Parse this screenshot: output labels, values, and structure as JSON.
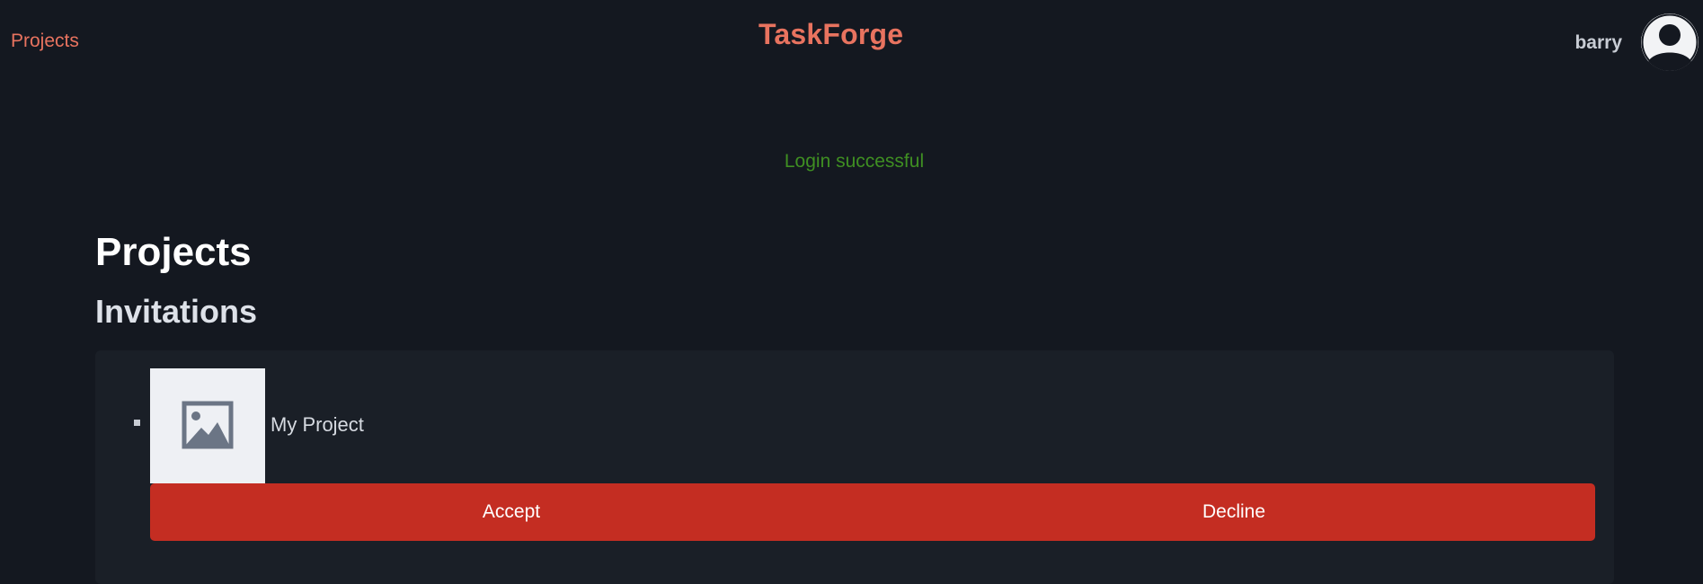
{
  "header": {
    "nav_projects_label": "Projects",
    "brand": "TaskForge",
    "username": "barry",
    "avatar_icon": "user-circle-icon"
  },
  "flash": {
    "message": "Login successful",
    "color": "#3f8f22"
  },
  "main": {
    "title": "Projects",
    "invitations": {
      "heading": "Invitations",
      "items": [
        {
          "project_name": "My Project",
          "thumbnail_icon": "image-placeholder-icon",
          "accept_label": "Accept",
          "decline_label": "Decline"
        }
      ]
    }
  },
  "colors": {
    "background": "#141820",
    "card": "#1a1f27",
    "accent": "#e8735f",
    "button": "#c42d22"
  }
}
